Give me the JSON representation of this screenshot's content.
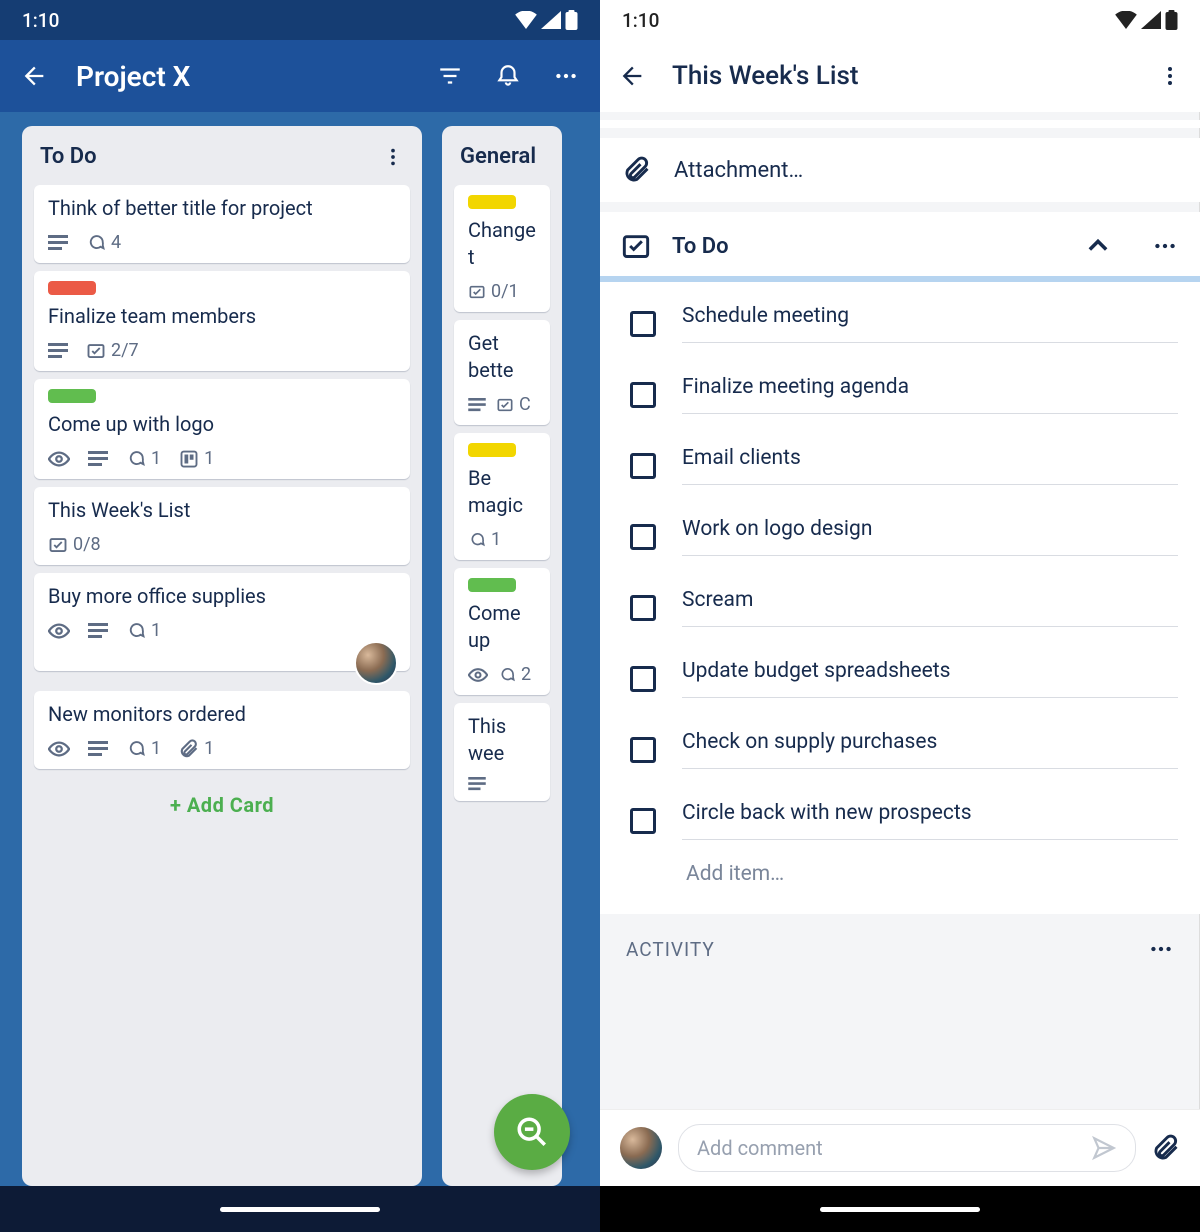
{
  "status": {
    "time": "1:10"
  },
  "left": {
    "title": "Project X",
    "list1": {
      "title": "To Do",
      "cards": [
        {
          "title": "Think of better title for project",
          "comments": "4"
        },
        {
          "title": "Finalize team members",
          "checklist": "2/7",
          "label": "red"
        },
        {
          "title": "Come up with logo",
          "comments": "1",
          "attachments": "1",
          "label": "green"
        },
        {
          "title": "This Week's List",
          "checklist": "0/8"
        },
        {
          "title": "Buy more office supplies",
          "comments": "1"
        },
        {
          "title": "New monitors ordered",
          "comments": "1",
          "attachments": "1"
        }
      ],
      "addCard": "+ Add Card"
    },
    "list2": {
      "title": "General",
      "cards": [
        {
          "title": "Change t",
          "checklist": "0/1",
          "label": "yellow"
        },
        {
          "title": "Get bette",
          "chk": "C"
        },
        {
          "title": "Be magic",
          "comments": "1",
          "label": "yellow"
        },
        {
          "title": "Come up",
          "comments": "2",
          "label": "green"
        },
        {
          "title": "This wee"
        }
      ]
    }
  },
  "right": {
    "title": "This Week's List",
    "attachmentLabel": "Attachment…",
    "checklistTitle": "To Do",
    "items": [
      "Schedule meeting",
      "Finalize meeting agenda",
      "Email clients",
      "Work on logo design",
      "Scream",
      "Update budget spreadsheets",
      "Check on supply purchases",
      "Circle back with new prospects"
    ],
    "addItem": "Add item…",
    "activityLabel": "ACTIVITY",
    "commentPlaceholder": "Add comment"
  }
}
